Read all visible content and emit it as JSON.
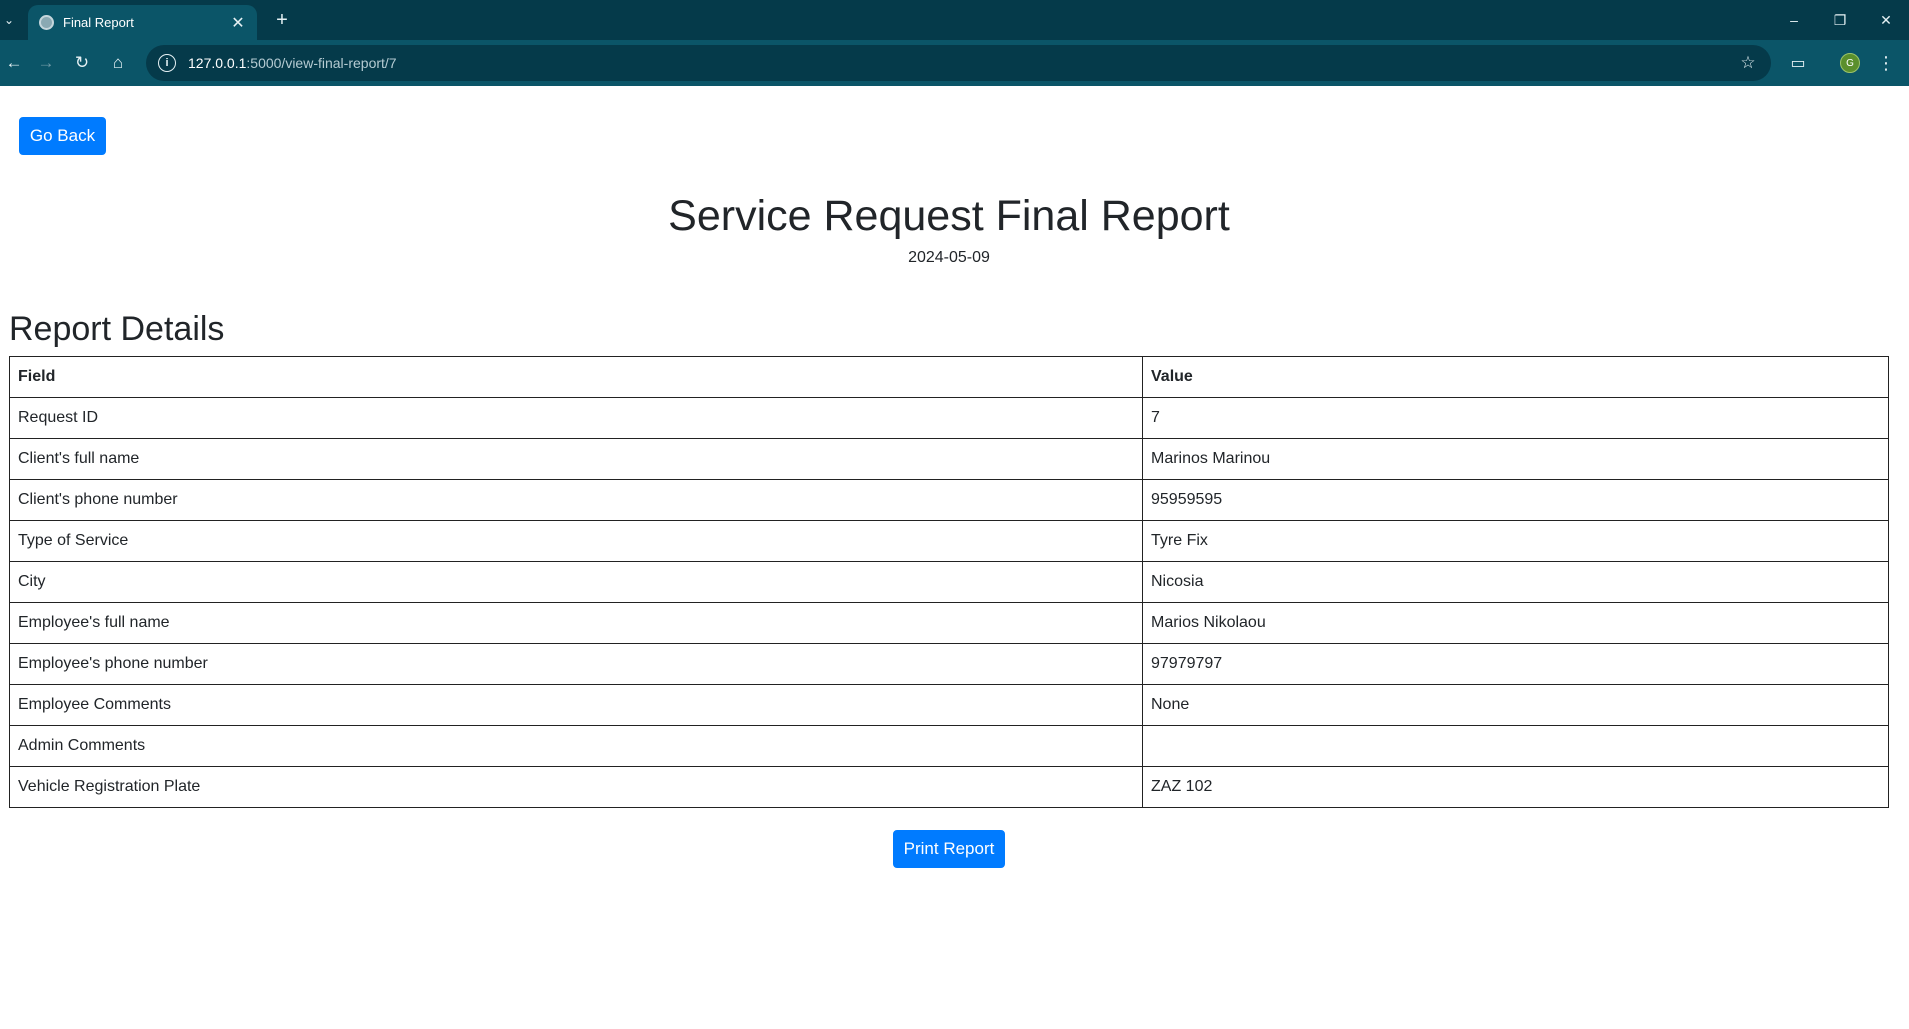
{
  "browser": {
    "tab_title": "Final Report",
    "url_host": "127.0.0.1",
    "url_path": ":5000/view-final-report/7",
    "profile_initial": "G",
    "accent_color": "#0b5568"
  },
  "page": {
    "go_back_label": "Go Back",
    "title": "Service Request Final Report",
    "date": "2024-05-09",
    "section_title": "Report Details",
    "print_label": "Print Report",
    "button_color": "#007bff"
  },
  "table": {
    "headers": [
      "Field",
      "Value"
    ],
    "rows": [
      {
        "field": "Request ID",
        "value": "7"
      },
      {
        "field": "Client's full name",
        "value": "Marinos Marinou"
      },
      {
        "field": "Client's phone number",
        "value": "95959595"
      },
      {
        "field": "Type of Service",
        "value": "Tyre Fix"
      },
      {
        "field": "City",
        "value": "Nicosia"
      },
      {
        "field": "Employee's full name",
        "value": "Marios Nikolaou"
      },
      {
        "field": "Employee's phone number",
        "value": "97979797"
      },
      {
        "field": "Employee Comments",
        "value": "None"
      },
      {
        "field": "Admin Comments",
        "value": ""
      },
      {
        "field": "Vehicle Registration Plate",
        "value": "ZAZ 102"
      }
    ]
  }
}
